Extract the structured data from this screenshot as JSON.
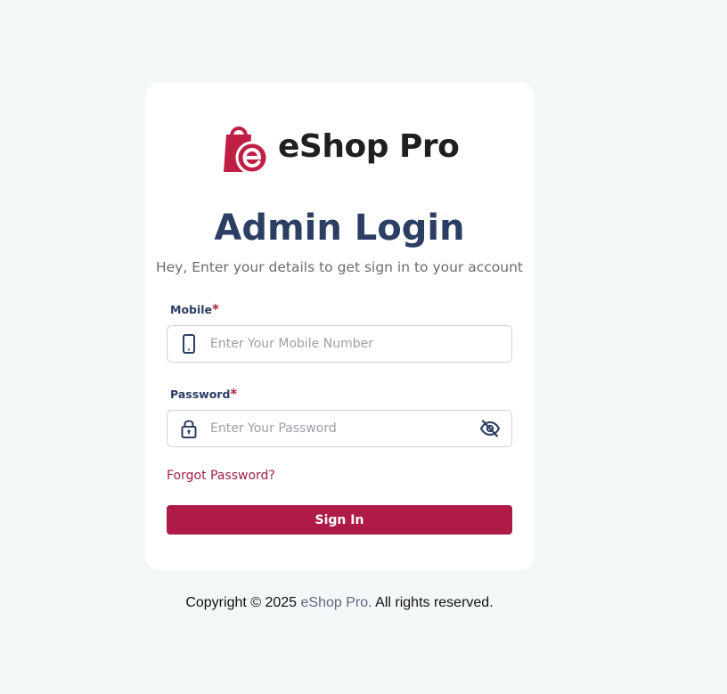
{
  "brand": {
    "name": "eShop Pro",
    "color": "#c01f45",
    "logo_icon": "shopping-bag-e-icon"
  },
  "login": {
    "title": "Admin Login",
    "subtitle": "Hey, Enter your details to get sign in to your account",
    "mobile": {
      "label": "Mobile",
      "required_mark": "*",
      "placeholder": "Enter Your Mobile Number",
      "value": "",
      "icon": "mobile-phone-icon"
    },
    "password": {
      "label": "Password",
      "required_mark": "*",
      "placeholder": "Enter Your Password",
      "value": "",
      "icon": "lock-icon",
      "toggle_icon": "eye-slash-icon"
    },
    "forgot_label": "Forgot Password?",
    "submit_label": "Sign In"
  },
  "footer": {
    "prefix": "Copyright © 2025 ",
    "brand": "eShop Pro.",
    "suffix": " All rights reserved."
  },
  "colors": {
    "accent": "#ad1b46",
    "heading": "#2c3e64",
    "background": "#f4f7f8"
  }
}
